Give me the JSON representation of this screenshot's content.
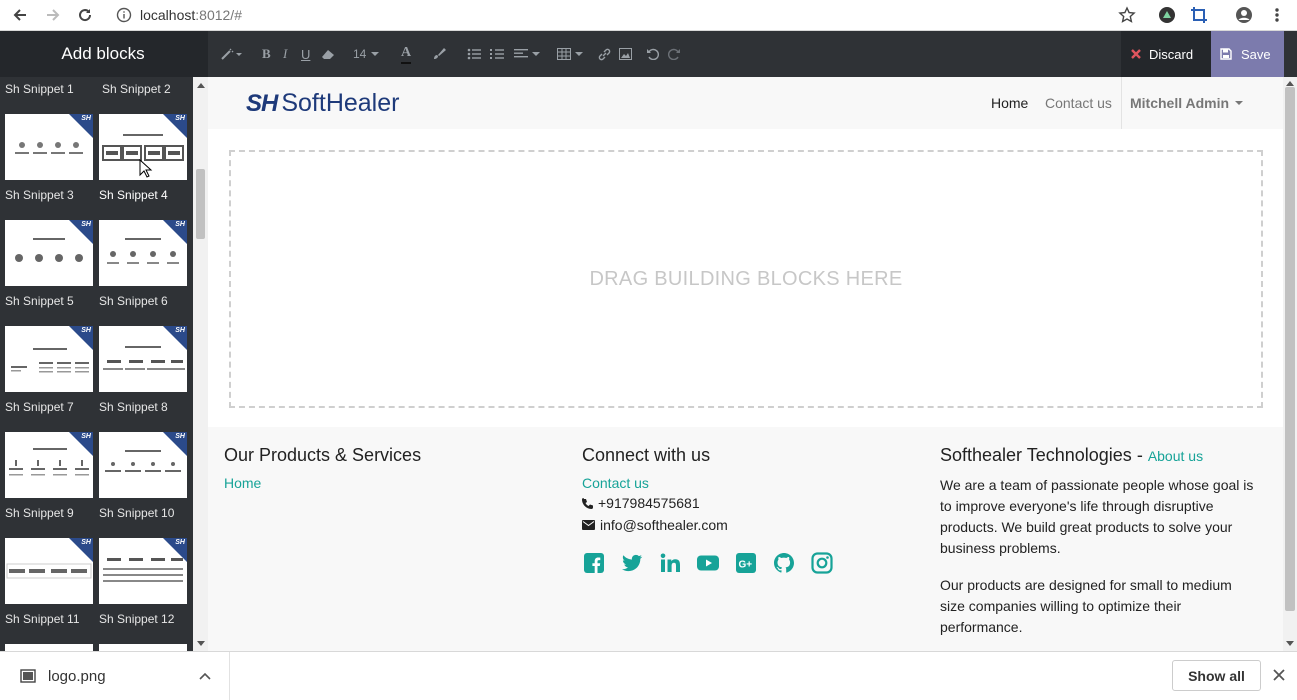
{
  "browser": {
    "url_host": "localhost",
    "url_rest": ":8012/#"
  },
  "sidebar": {
    "title": "Add blocks",
    "top_labels": [
      "Sh Snippet 1",
      "Sh Snippet 2"
    ],
    "badge": "SH",
    "snippets": [
      {
        "label": "Sh Snippet 3"
      },
      {
        "label": "Sh Snippet 4"
      },
      {
        "label": "Sh Snippet 5"
      },
      {
        "label": "Sh Snippet 6"
      },
      {
        "label": "Sh Snippet 7"
      },
      {
        "label": "Sh Snippet 8"
      },
      {
        "label": "Sh Snippet 9"
      },
      {
        "label": "Sh Snippet 10"
      },
      {
        "label": "Sh Snippet 11"
      },
      {
        "label": "Sh Snippet 12"
      }
    ]
  },
  "toolbar": {
    "font_size": "14",
    "discard_label": "Discard",
    "save_label": "Save"
  },
  "site": {
    "logo_mark": "SH",
    "logo_name": "SoftHealer",
    "nav": {
      "home": "Home",
      "contact": "Contact us",
      "user": "Mitchell Admin"
    },
    "dropzone_text": "DRAG BUILDING BLOCKS HERE"
  },
  "footer": {
    "col1": {
      "heading": "Our Products & Services",
      "link": "Home"
    },
    "col2": {
      "heading": "Connect with us",
      "link": "Contact us",
      "phone": "+917984575681",
      "email": "info@softhealer.com",
      "social_icons": [
        "facebook-icon",
        "twitter-icon",
        "linkedin-icon",
        "youtube-icon",
        "google-plus-icon",
        "github-icon",
        "instagram-icon"
      ]
    },
    "col3": {
      "heading": "Softhealer Technologies",
      "separator": " - ",
      "about": "About us",
      "p1": "We are a team of passionate people whose goal is to improve everyone's life through disruptive products. We build great products to solve your business problems.",
      "p2": "Our products are designed for small to medium size companies willing to optimize their performance."
    }
  },
  "downloads": {
    "file": "logo.png",
    "show_all": "Show all"
  },
  "colors": {
    "accent": "#17a398",
    "save": "#7c7bad",
    "editor_dark": "#2f3236",
    "logo_blue": "#1e3a7a"
  }
}
